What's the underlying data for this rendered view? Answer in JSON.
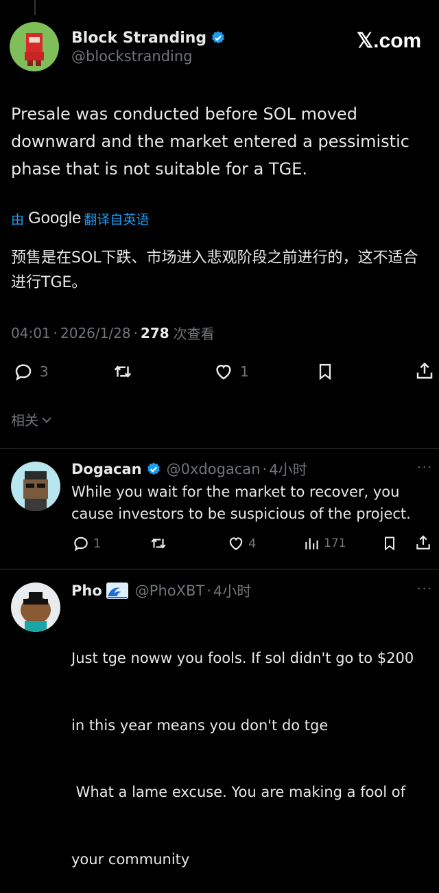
{
  "main_tweet": {
    "display_name": "Block Stranding",
    "handle": "@blockstranding",
    "site_logo": "𝕏.com",
    "text": "Presale was conducted before SOL moved downward and the market entered a pessimistic phase that is not suitable for a TGE.",
    "translation_prefix": "由",
    "translation_brand": "Google",
    "translation_suffix": "翻译自英语",
    "translated_text": "预售是在SOL下跌、市场进入悲观阶段之前进行的，这不适合进行TGE。",
    "time": "04:01",
    "date": "2026/1/28",
    "sep": "·",
    "views_count": "278",
    "views_label": "次查看",
    "replies": "3",
    "likes": "1",
    "related_label": "相关"
  },
  "replies": [
    {
      "display_name": "Dogacan",
      "handle": "@0xdogacan",
      "time": "4小时",
      "text": "While you wait for the market to recover, you cause investors to be suspicious of the project.",
      "replies": "1",
      "likes": "4",
      "views": "171"
    },
    {
      "display_name": "Pho",
      "handle": "@PhoXBT",
      "time": "4小时",
      "text_lines": [
        "Just tge noww you fools. If sol didn't go to $200",
        "in this year means you don't do tge",
        " What a lame excuse. You are making a fool of",
        "your community"
      ]
    }
  ],
  "colors": {
    "background": "#000000",
    "text": "#e7e9ea",
    "muted": "#71767b",
    "link": "#1d9bf0",
    "verified": "#1d9bf0"
  }
}
